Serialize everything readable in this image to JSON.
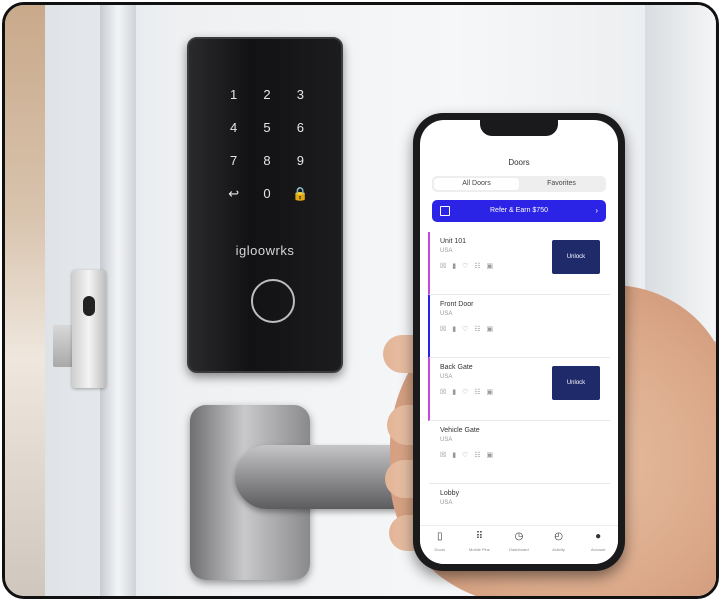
{
  "keypad": {
    "keys": [
      "1",
      "2",
      "3",
      "4",
      "5",
      "6",
      "7",
      "8",
      "9",
      "↩",
      "0",
      "🔒"
    ],
    "brand": "igloowrks"
  },
  "app": {
    "title": "Doors",
    "tabs": [
      {
        "label": "All Doors"
      },
      {
        "label": "Favorites"
      }
    ],
    "refer_label": "Refer & Earn $750",
    "doors": [
      {
        "name": "Unit 101",
        "country": "USA",
        "icons": "☒ ▮ ♡ ☷ ▣",
        "button": "Unlock"
      },
      {
        "name": "Front Door",
        "country": "USA",
        "icons": "☒ ▮ ♡ ☷ ▣",
        "button": ""
      },
      {
        "name": "Back Gate",
        "country": "USA",
        "icons": "☒ ▮ ♡ ☷ ▣",
        "button": "Unlock"
      },
      {
        "name": "Vehicle Gate",
        "country": "USA",
        "icons": "☒ ▮ ♡ ☷ ▣",
        "button": ""
      },
      {
        "name": "Lobby",
        "country": "USA",
        "icons": "",
        "button": ""
      }
    ],
    "tabbar": [
      {
        "label": "Doors",
        "icon": "door-icon"
      },
      {
        "label": "Mobile Pins",
        "icon": "keypad-icon"
      },
      {
        "label": "Dashboard",
        "icon": "dashboard-icon"
      },
      {
        "label": "Activity",
        "icon": "clock-icon"
      },
      {
        "label": "Account",
        "icon": "account-icon"
      }
    ]
  }
}
